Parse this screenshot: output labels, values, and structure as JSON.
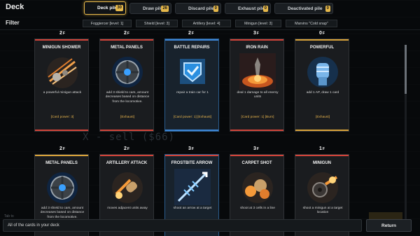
{
  "header": {
    "title": "Deck",
    "tabs": [
      {
        "label": "Deck pile",
        "count": "30",
        "active": true
      },
      {
        "label": "Draw pile",
        "count": "26",
        "active": false
      },
      {
        "label": "Discard pile",
        "count": "0",
        "active": false
      },
      {
        "label": "Exhaust pile",
        "count": "0",
        "active": false
      },
      {
        "label": "Deactivated pile",
        "count": "0",
        "active": false
      }
    ]
  },
  "filter": {
    "title": "Filter",
    "chips": [
      "Foggiercer [level: 1]",
      "Shield [level: 3]",
      "Artillery [level: 4]",
      "Minigun [level: 3]",
      "Marvins \"Cold snap\""
    ]
  },
  "background_text": "X - sell ($66)",
  "cards": [
    {
      "name": "MINIGUN SHOWER",
      "cost": "2",
      "desc": "a powerful minigun attack",
      "tags": "[Card power: 3]",
      "art": "minigun-shower-art"
    },
    {
      "name": "METAL PANELS",
      "cost": "2",
      "desc": "add 3 shield to cars, amount decreases based on distance from the locomotive.",
      "tags": "[Exhaust]",
      "art": "metal-panels-art"
    },
    {
      "name": "BATTLE REPAIRS",
      "cost": "2",
      "desc": "repair a train car for 1",
      "tags": "[Card power: 1] [Exhaust]",
      "art": "battle-repairs-art",
      "blue": true
    },
    {
      "name": "IRON RAIN",
      "cost": "3",
      "desc": "deal 1 damage to all enemy units",
      "tags": "[Card power: 1] [Burn]",
      "art": "iron-rain-art"
    },
    {
      "name": "POWERFUL",
      "cost": "0",
      "desc": "add 1 AP, draw 1 card",
      "tags": "[Exhaust]",
      "art": "powerful-art"
    },
    {
      "name": "METAL PANELS",
      "cost": "2",
      "desc": "add 3 shield to cars, amount decreases based on distance from the locomotive.",
      "tags": "",
      "art": "metal-panels-art"
    },
    {
      "name": "ARTILLERY ATTACK",
      "cost": "2",
      "desc": "moves adjacent units away",
      "tags": "",
      "art": "artillery-attack-art"
    },
    {
      "name": "FROSTBITE ARROW",
      "cost": "3",
      "desc": "shoot an arrow at a target",
      "tags": "",
      "art": "frostbite-arrow-art"
    },
    {
      "name": "CARPET SHOT",
      "cost": "3",
      "desc": "shoot at 3 cells in a line",
      "tags": "",
      "art": "carpet-shot-art"
    },
    {
      "name": "MINIGUN",
      "cost": "1",
      "desc": "shoot a minigun at a target location",
      "tags": "",
      "art": "minigun-art"
    }
  ],
  "cost_symbol": "F",
  "footer": {
    "hint": "Tab to",
    "description": "All of the cards in your deck",
    "return_label": "Return"
  },
  "colors": {
    "accent": "#e6b84a",
    "tag_text": "#e9b54d",
    "rarity_red": "#d2443a",
    "rarity_blue": "#3e86d6",
    "rarity_gold": "#d9a33a"
  }
}
